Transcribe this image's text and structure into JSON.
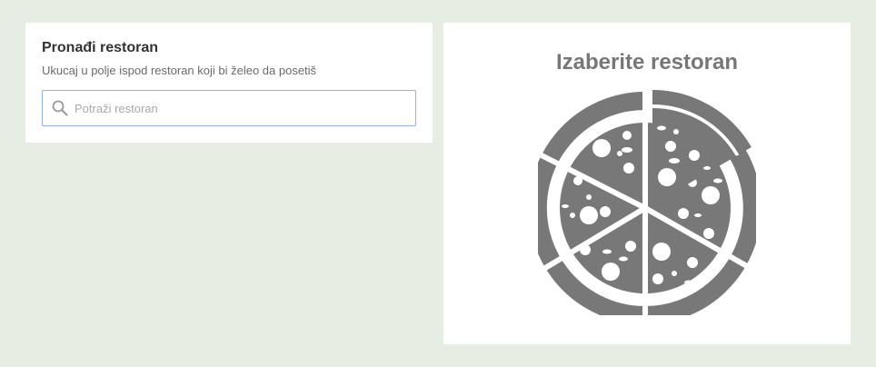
{
  "search": {
    "title": "Pronađi restoran",
    "subtitle": "Ukucaj u polje ispod restoran koji bi želeo da posetiš",
    "placeholder": "Potraži restoran",
    "value": "",
    "icon": "search-icon"
  },
  "selection": {
    "title": "Izaberite restoran",
    "illustration": "pizza-icon"
  },
  "colors": {
    "background": "#e6ede2",
    "card": "#ffffff",
    "pizza": "#787878",
    "input_border": "#8fb1e6"
  }
}
